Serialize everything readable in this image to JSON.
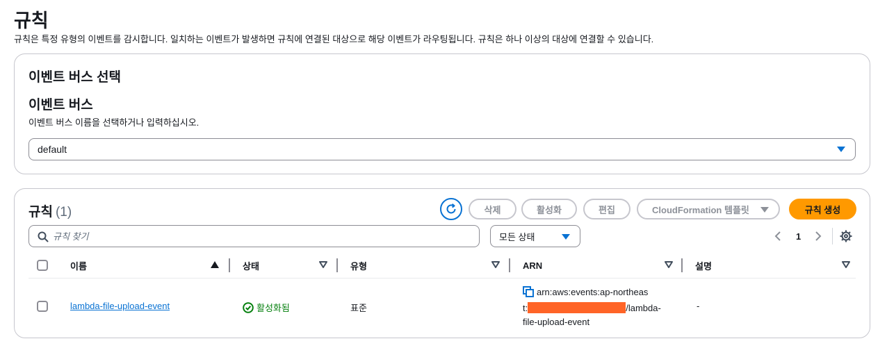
{
  "page": {
    "title": "규칙",
    "description": "규칙은 특정 유형의 이벤트를 감시합니다. 일치하는 이벤트가 발생하면 규칙에 연결된 대상으로 해당 이벤트가 라우팅됩니다. 규칙은 하나 이상의 대상에 연결할 수 있습니다."
  },
  "event_bus": {
    "section_title": "이벤트 버스 선택",
    "label": "이벤트 버스",
    "description": "이벤트 버스 이름을 선택하거나 입력하십시오.",
    "selected": "default"
  },
  "rules": {
    "title": "규칙",
    "count": "(1)",
    "buttons": {
      "delete": "삭제",
      "activate": "활성화",
      "edit": "편집",
      "cloudformation": "CloudFormation 템플릿",
      "create": "규칙 생성"
    },
    "search_placeholder": "규칙 찾기",
    "status_filter": "모든 상태",
    "page": "1",
    "columns": [
      "이름",
      "상태",
      "유형",
      "ARN",
      "설명"
    ],
    "rows": [
      {
        "name": "lambda-file-upload-event",
        "status": "활성화됨",
        "type": "표준",
        "arn_line1": "arn:aws:events:ap-northeas",
        "arn_line2_prefix": "t:",
        "arn_line2_suffix": "/lambda-",
        "arn_line3": "file-upload-event",
        "description": "-"
      }
    ]
  },
  "colors": {
    "accent": "#0972d3",
    "primary_button": "#ff9900",
    "success": "#037f0c",
    "redaction": "#ff6427"
  }
}
